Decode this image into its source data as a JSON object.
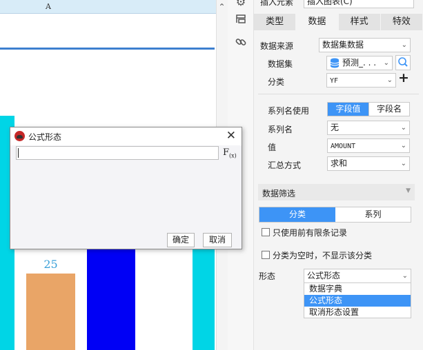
{
  "canvas": {
    "column_header": "A"
  },
  "chart_data": {
    "type": "bar",
    "bars": [
      {
        "color": "#00d5e6"
      },
      {
        "color": "#e9a567",
        "label": "25"
      },
      {
        "color": "#0000f5"
      },
      {
        "color": "#00d5e6"
      }
    ]
  },
  "panel": {
    "top": {
      "label": "插入元素",
      "value": "插入图表(C)"
    },
    "tabs": [
      "类型",
      "数据",
      "样式",
      "特效"
    ],
    "active_tab": "数据",
    "data_source": {
      "label": "数据来源",
      "value": "数据集数据"
    },
    "dataset": {
      "label": "数据集",
      "value": "预测_. . ."
    },
    "category": {
      "label": "分类",
      "value": "YF",
      "add": "+"
    },
    "series_use": {
      "label": "系列名使用",
      "options": [
        "字段值",
        "字段名"
      ],
      "selected": "字段值"
    },
    "series_name": {
      "label": "系列名",
      "value": "无"
    },
    "value": {
      "label": "值",
      "value": "AMOUNT"
    },
    "summary": {
      "label": "汇总方式",
      "value": "求和"
    },
    "filter": {
      "header": "数据筛选",
      "tabs": [
        "分类",
        "系列"
      ],
      "selected": "分类",
      "only_first_n": "只使用前有限条记录",
      "hide_empty": "分类为空时，不显示该分类"
    },
    "form": {
      "label": "形态",
      "value": "公式形态",
      "options": [
        "数据字典",
        "公式形态",
        "取消形态设置"
      ],
      "highlighted": "公式形态"
    }
  },
  "dialog": {
    "title": "公式形态",
    "input_value": "",
    "fx_label": "F",
    "fx_sub": "(x)",
    "ok": "确定",
    "cancel": "取消"
  },
  "colors": {
    "accent": "#3d94f6",
    "header_blue": "#d8ecf8",
    "rule_blue": "#3d7fcf"
  }
}
